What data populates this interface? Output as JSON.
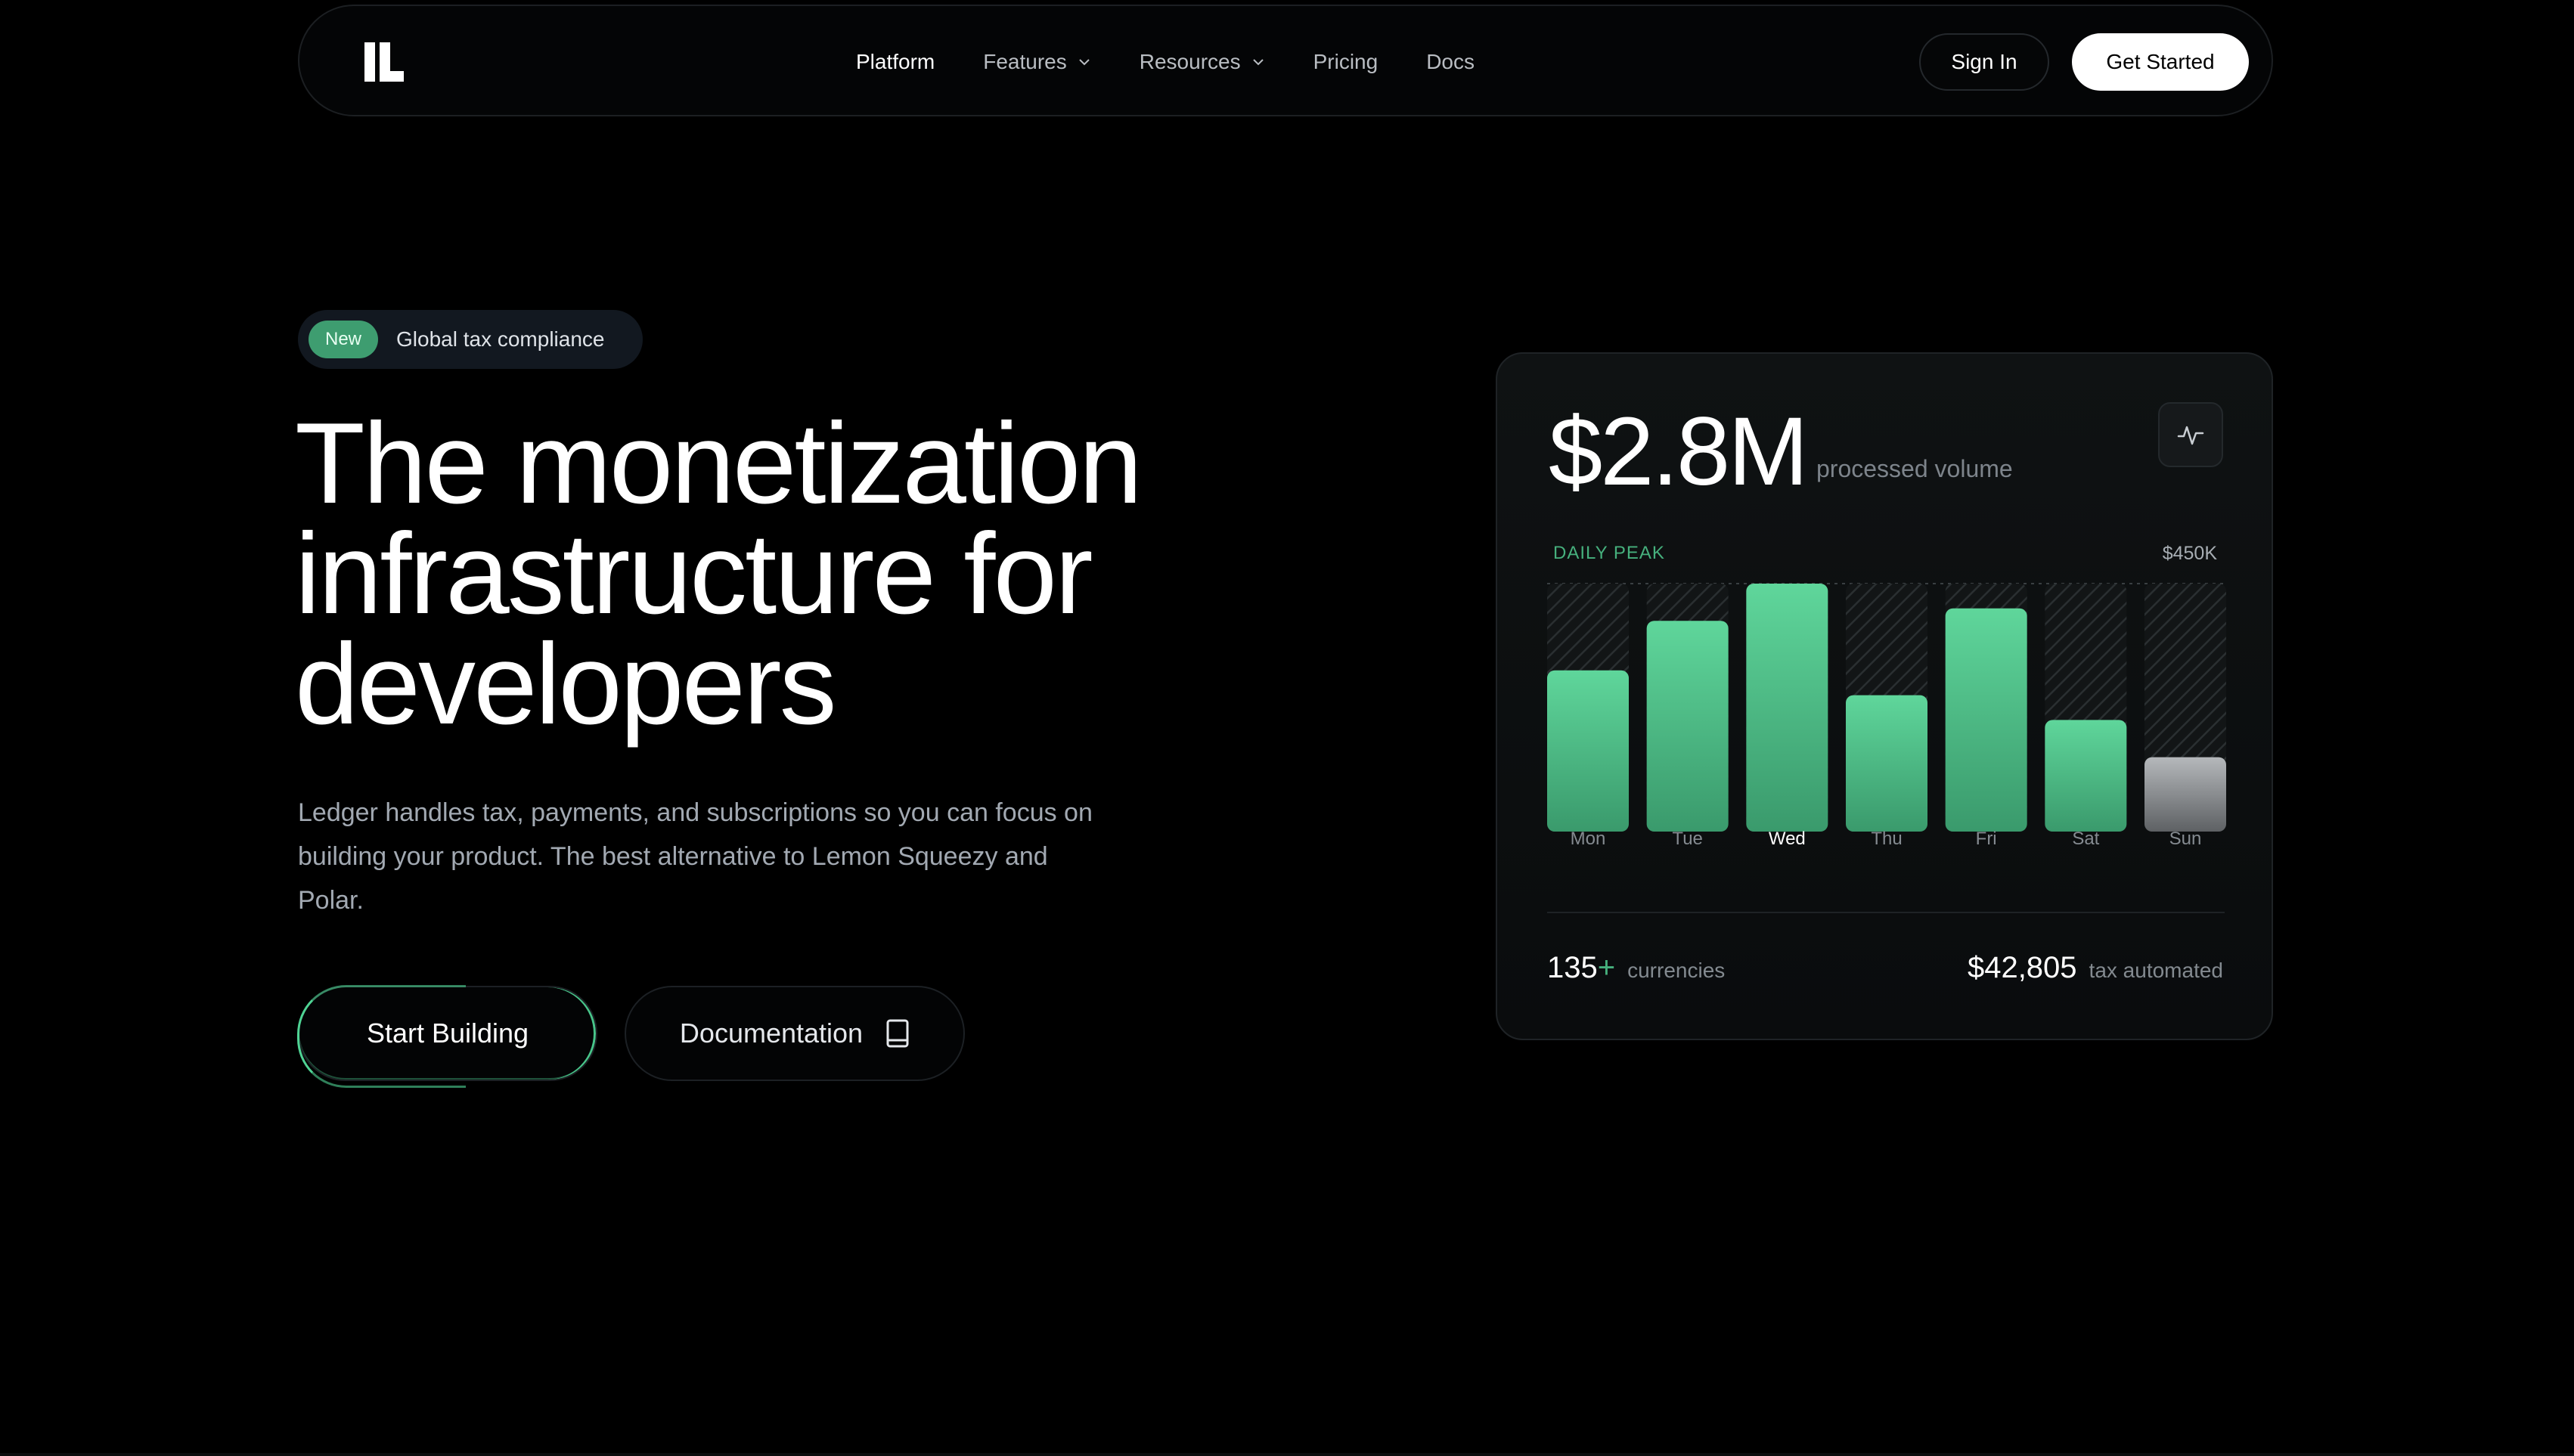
{
  "nav": {
    "items": [
      {
        "label": "Platform",
        "active": true,
        "dropdown": false
      },
      {
        "label": "Features",
        "active": false,
        "dropdown": true
      },
      {
        "label": "Resources",
        "active": false,
        "dropdown": true
      },
      {
        "label": "Pricing",
        "active": false,
        "dropdown": false
      },
      {
        "label": "Docs",
        "active": false,
        "dropdown": false
      }
    ],
    "sign_in": "Sign In",
    "get_started": "Get Started"
  },
  "hero": {
    "badge_tag": "New",
    "badge_text": "Global tax compliance",
    "headline_lines": [
      "The monetization",
      "infrastructure for",
      "developers"
    ],
    "subtext": "Ledger handles tax, payments, and subscriptions so you can focus on building your product. The best alternative to Lemon Squeezy and Polar.",
    "primary_cta": "Start Building",
    "secondary_cta": "Documentation"
  },
  "card": {
    "volume": "$2.8M",
    "volume_label": "processed volume",
    "peak_label": "DAILY PEAK",
    "peak_value": "$450K",
    "currencies_num": "135",
    "currencies_plus": "+",
    "currencies_label": "currencies",
    "tax_num": "$42,805",
    "tax_label": "tax automated"
  },
  "chart_data": {
    "type": "bar",
    "categories": [
      "Mon",
      "Tue",
      "Wed",
      "Thu",
      "Fri",
      "Sat",
      "Sun"
    ],
    "values": [
      0.65,
      0.85,
      1.0,
      0.55,
      0.9,
      0.45,
      0.3
    ],
    "active_category": "Wed",
    "bar_color": "#4fc88b",
    "muted_bar_color": "#8a8e92",
    "muted_categories": [
      "Sun"
    ],
    "ylim": [
      0,
      1
    ]
  },
  "colors": {
    "accent": "#46b07d",
    "background": "#000000",
    "card": "#0e1112"
  }
}
